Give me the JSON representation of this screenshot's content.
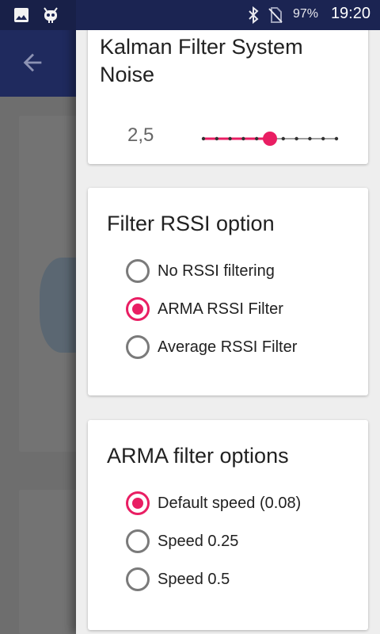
{
  "status_bar": {
    "icons": [
      "image-icon",
      "android-robot-icon",
      "bluetooth-icon",
      "no-sim-icon"
    ],
    "battery": "97%",
    "time": "19:20"
  },
  "app_bar": {
    "back_icon": "arrow-back-icon"
  },
  "cards": {
    "noise": {
      "title": "Kalman Filter System Noise",
      "value": "2,5",
      "slider": {
        "steps": 11,
        "selected_index": 5,
        "accent": "#e91e63"
      }
    },
    "rssi": {
      "title": "Filter RSSI option",
      "options": [
        "No RSSI filtering",
        "ARMA RSSI Filter",
        "Average RSSI Filter"
      ],
      "selected": 1
    },
    "arma": {
      "title": "ARMA filter options",
      "options": [
        "Default speed (0.08)",
        "Speed 0.25",
        "Speed 0.5"
      ],
      "selected": 0
    }
  },
  "colors": {
    "accent": "#e91e63",
    "app_bar": "#1f2a5e",
    "radio_off": "#7a7a7a"
  }
}
